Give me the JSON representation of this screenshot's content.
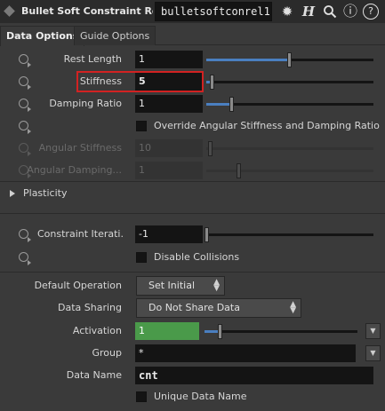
{
  "header": {
    "node_type": "Bullet Soft Constraint Rel...",
    "node_name": "bulletsoftconrel1",
    "icons": [
      "gear-icon",
      "houdini-help-icon",
      "search-icon",
      "info-icon",
      "help-icon"
    ],
    "info_glyph": "ⓘ",
    "help_glyph": "?"
  },
  "tabs": [
    {
      "label": "Data Options",
      "active": true
    },
    {
      "label": "Guide Options",
      "active": false
    }
  ],
  "params": {
    "rest_length": {
      "label": "Rest Length",
      "value": "1",
      "slider_fraction": 0.5
    },
    "stiffness": {
      "label": "Stiffness",
      "value": "5",
      "slider_fraction": 0.03,
      "highlighted": true
    },
    "damping_ratio": {
      "label": "Damping Ratio",
      "value": "1",
      "slider_fraction": 0.15
    },
    "override": {
      "label": "Override Angular Stiffness and Damping Ratio",
      "checked": false
    },
    "angular_stiffness": {
      "label": "Angular Stiffness",
      "value": "10",
      "disabled": true
    },
    "angular_damping": {
      "label": "Angular Damping...",
      "value": "1",
      "disabled": true
    },
    "plasticity": {
      "label": "Plasticity",
      "collapsed": true
    },
    "constraint_iterations": {
      "label": "Constraint Iterati...",
      "value": "-1",
      "slider_fraction": 0.0
    },
    "disable_collisions": {
      "label": "Disable Collisions",
      "checked": false
    },
    "default_operation": {
      "label": "Default Operation",
      "value": "Set Initial"
    },
    "data_sharing": {
      "label": "Data Sharing",
      "value": "Do Not Share Data"
    },
    "activation": {
      "label": "Activation",
      "value": "1",
      "slider_fraction": 0.08,
      "accent": "#4a9a4a"
    },
    "group": {
      "label": "Group",
      "value": "*"
    },
    "data_name": {
      "label": "Data Name",
      "value": "cnt"
    },
    "unique_data_name": {
      "label": "Unique Data Name",
      "checked": false
    }
  },
  "colors": {
    "background": "#3a3a3a",
    "field": "#141414",
    "slider_fill": "#4a7fc0",
    "highlight_box": "#d22222"
  }
}
